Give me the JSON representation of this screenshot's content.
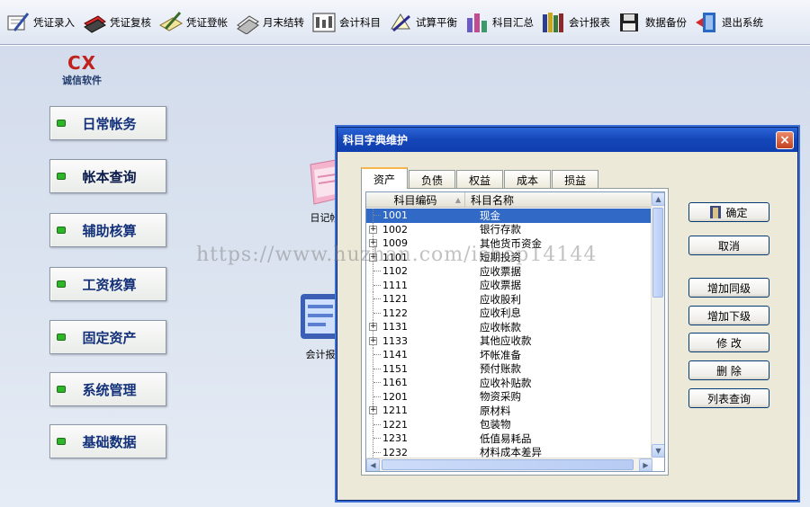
{
  "toolbar": {
    "items": [
      {
        "label": "凭证录入",
        "icon": "voucher-entry-icon"
      },
      {
        "label": "凭证复核",
        "icon": "voucher-review-icon"
      },
      {
        "label": "凭证登帐",
        "icon": "voucher-post-icon"
      },
      {
        "label": "月末结转",
        "icon": "month-end-icon"
      },
      {
        "label": "会计科目",
        "icon": "accounts-icon"
      },
      {
        "label": "试算平衡",
        "icon": "trial-balance-icon"
      },
      {
        "label": "科目汇总",
        "icon": "summary-icon"
      },
      {
        "label": "会计报表",
        "icon": "reports-icon"
      },
      {
        "label": "数据备份",
        "icon": "backup-icon"
      },
      {
        "label": "退出系统",
        "icon": "exit-icon"
      }
    ]
  },
  "logo": {
    "mark": "CX",
    "name": "诚信软件"
  },
  "sidebar": {
    "items": [
      {
        "label": "日常帐务"
      },
      {
        "label": "帐本查询"
      },
      {
        "label": "辅助核算"
      },
      {
        "label": "工资核算"
      },
      {
        "label": "固定资产"
      },
      {
        "label": "系统管理"
      },
      {
        "label": "基础数据"
      }
    ]
  },
  "desktop": {
    "icon1": "日记帐",
    "icon2": "会计报"
  },
  "dialog": {
    "title": "科目字典维护",
    "close": "×",
    "tabs": [
      {
        "label": "资产"
      },
      {
        "label": "负债"
      },
      {
        "label": "权益"
      },
      {
        "label": "成本"
      },
      {
        "label": "损益"
      }
    ],
    "columns": {
      "code": "科目编码",
      "name": "科目名称"
    },
    "rows": [
      {
        "code": "1001",
        "name": "现金",
        "expandable": false,
        "selected": true
      },
      {
        "code": "1002",
        "name": "银行存款",
        "expandable": true
      },
      {
        "code": "1009",
        "name": "其他货币资金",
        "expandable": true
      },
      {
        "code": "1101",
        "name": "短期投资",
        "expandable": true
      },
      {
        "code": "1102",
        "name": "应收票据",
        "expandable": false
      },
      {
        "code": "1111",
        "name": "应收票据",
        "expandable": false
      },
      {
        "code": "1121",
        "name": "应收股利",
        "expandable": false
      },
      {
        "code": "1122",
        "name": "应收利息",
        "expandable": false
      },
      {
        "code": "1131",
        "name": "应收帐款",
        "expandable": true
      },
      {
        "code": "1133",
        "name": "其他应收款",
        "expandable": true
      },
      {
        "code": "1141",
        "name": "坏帐准备",
        "expandable": false
      },
      {
        "code": "1151",
        "name": "预付账款",
        "expandable": false
      },
      {
        "code": "1161",
        "name": "应收补贴款",
        "expandable": false
      },
      {
        "code": "1201",
        "name": "物资采购",
        "expandable": false
      },
      {
        "code": "1211",
        "name": "原材料",
        "expandable": true
      },
      {
        "code": "1221",
        "name": "包装物",
        "expandable": false
      },
      {
        "code": "1231",
        "name": "低值易耗品",
        "expandable": false
      },
      {
        "code": "1232",
        "name": "材料成本差异",
        "expandable": false
      }
    ],
    "buttons": {
      "ok": "确定",
      "cancel": "取消",
      "add_same": "增加同级",
      "add_child": "增加下级",
      "edit": "修 改",
      "delete": "删 除",
      "list": "列表查询"
    }
  },
  "watermark": "https://www.huzhan.com/ishop14144"
}
